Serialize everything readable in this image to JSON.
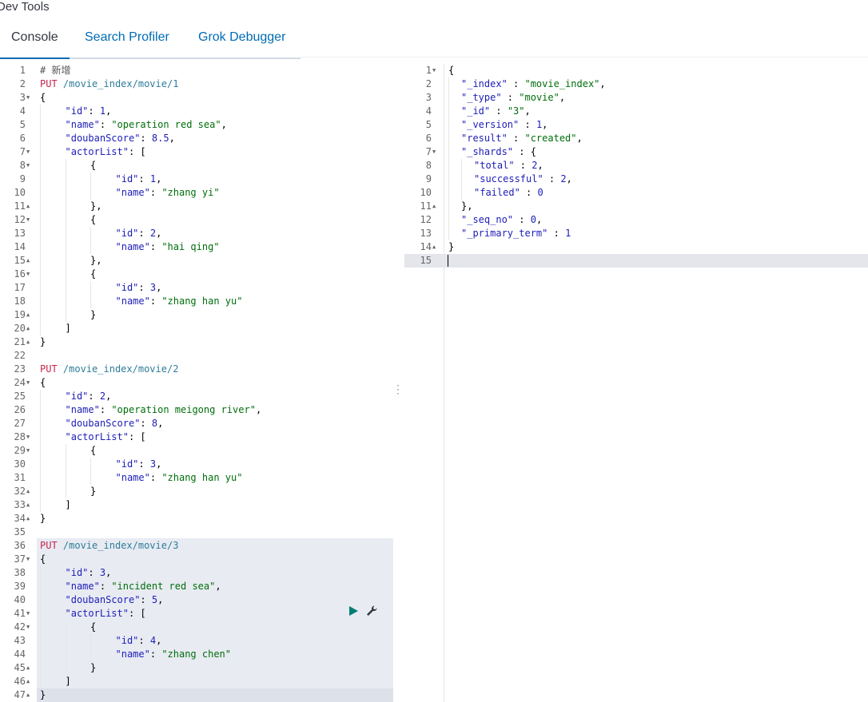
{
  "app_title": "Dev Tools",
  "tabs": [
    {
      "label": "Console"
    },
    {
      "label": "Search Profiler"
    },
    {
      "label": "Grok Debugger"
    }
  ],
  "request_editor": {
    "lines": [
      {
        "n": "1",
        "t": "# 新增",
        "s": "comment",
        "i": 0,
        "f": ""
      },
      {
        "n": "2",
        "t": "PUT /movie_index/movie/1",
        "s": "req",
        "i": 0,
        "f": ""
      },
      {
        "n": "3",
        "t": "{",
        "s": "",
        "i": 0,
        "f": "open"
      },
      {
        "n": "4",
        "t": "\"id\": 1,",
        "s": "",
        "i": 1,
        "f": ""
      },
      {
        "n": "5",
        "t": "\"name\": \"operation red sea\",",
        "s": "",
        "i": 1,
        "f": ""
      },
      {
        "n": "6",
        "t": "\"doubanScore\": 8.5,",
        "s": "",
        "i": 1,
        "f": ""
      },
      {
        "n": "7",
        "t": "\"actorList\": [",
        "s": "",
        "i": 1,
        "f": "open"
      },
      {
        "n": "8",
        "t": "{",
        "s": "",
        "i": 2,
        "f": "open"
      },
      {
        "n": "9",
        "t": "\"id\": 1,",
        "s": "",
        "i": 3,
        "f": ""
      },
      {
        "n": "10",
        "t": "\"name\": \"zhang yi\"",
        "s": "",
        "i": 3,
        "f": ""
      },
      {
        "n": "11",
        "t": "},",
        "s": "",
        "i": 2,
        "f": "close"
      },
      {
        "n": "12",
        "t": "{",
        "s": "",
        "i": 2,
        "f": "open"
      },
      {
        "n": "13",
        "t": "\"id\": 2,",
        "s": "",
        "i": 3,
        "f": ""
      },
      {
        "n": "14",
        "t": "\"name\": \"hai qing\"",
        "s": "",
        "i": 3,
        "f": ""
      },
      {
        "n": "15",
        "t": "},",
        "s": "",
        "i": 2,
        "f": "close"
      },
      {
        "n": "16",
        "t": "{",
        "s": "",
        "i": 2,
        "f": "open"
      },
      {
        "n": "17",
        "t": "\"id\": 3,",
        "s": "",
        "i": 3,
        "f": ""
      },
      {
        "n": "18",
        "t": "\"name\": \"zhang han yu\"",
        "s": "",
        "i": 3,
        "f": ""
      },
      {
        "n": "19",
        "t": "}",
        "s": "",
        "i": 2,
        "f": "close"
      },
      {
        "n": "20",
        "t": "]",
        "s": "",
        "i": 1,
        "f": "close"
      },
      {
        "n": "21",
        "t": "}",
        "s": "",
        "i": 0,
        "f": "close"
      },
      {
        "n": "22",
        "t": "",
        "s": "",
        "i": 0,
        "f": ""
      },
      {
        "n": "23",
        "t": "PUT /movie_index/movie/2",
        "s": "req",
        "i": 0,
        "f": ""
      },
      {
        "n": "24",
        "t": "{",
        "s": "",
        "i": 0,
        "f": "open"
      },
      {
        "n": "25",
        "t": "\"id\": 2,",
        "s": "",
        "i": 1,
        "f": ""
      },
      {
        "n": "26",
        "t": "\"name\": \"operation meigong river\",",
        "s": "",
        "i": 1,
        "f": ""
      },
      {
        "n": "27",
        "t": "\"doubanScore\": 8,",
        "s": "",
        "i": 1,
        "f": ""
      },
      {
        "n": "28",
        "t": "\"actorList\": [",
        "s": "",
        "i": 1,
        "f": "open"
      },
      {
        "n": "29",
        "t": "{",
        "s": "",
        "i": 2,
        "f": "open"
      },
      {
        "n": "30",
        "t": "\"id\": 3,",
        "s": "",
        "i": 3,
        "f": ""
      },
      {
        "n": "31",
        "t": "\"name\": \"zhang han yu\"",
        "s": "",
        "i": 3,
        "f": ""
      },
      {
        "n": "32",
        "t": "}",
        "s": "",
        "i": 2,
        "f": "close"
      },
      {
        "n": "33",
        "t": "]",
        "s": "",
        "i": 1,
        "f": "close"
      },
      {
        "n": "34",
        "t": "}",
        "s": "",
        "i": 0,
        "f": "close"
      },
      {
        "n": "35",
        "t": "",
        "s": "",
        "i": 0,
        "f": ""
      },
      {
        "n": "36",
        "t": "PUT /movie_index/movie/3",
        "s": "req",
        "i": 0,
        "f": ""
      },
      {
        "n": "37",
        "t": "{",
        "s": "",
        "i": 0,
        "f": "open"
      },
      {
        "n": "38",
        "t": "\"id\": 3,",
        "s": "",
        "i": 1,
        "f": ""
      },
      {
        "n": "39",
        "t": "\"name\": \"incident red sea\",",
        "s": "",
        "i": 1,
        "f": ""
      },
      {
        "n": "40",
        "t": "\"doubanScore\": 5,",
        "s": "",
        "i": 1,
        "f": ""
      },
      {
        "n": "41",
        "t": "\"actorList\": [",
        "s": "",
        "i": 1,
        "f": "open"
      },
      {
        "n": "42",
        "t": "{",
        "s": "",
        "i": 2,
        "f": "open"
      },
      {
        "n": "43",
        "t": "\"id\": 4,",
        "s": "",
        "i": 3,
        "f": ""
      },
      {
        "n": "44",
        "t": "\"name\": \"zhang chen\"",
        "s": "",
        "i": 3,
        "f": ""
      },
      {
        "n": "45",
        "t": "}",
        "s": "",
        "i": 2,
        "f": "close"
      },
      {
        "n": "46",
        "t": "]",
        "s": "",
        "i": 1,
        "f": "close"
      },
      {
        "n": "47",
        "t": "}",
        "s": "",
        "i": 0,
        "f": "close"
      }
    ]
  },
  "response_editor": {
    "lines": [
      {
        "n": "1",
        "t": "{",
        "i": 0,
        "f": "open"
      },
      {
        "n": "2",
        "t": "\"_index\" : \"movie_index\",",
        "i": 1,
        "f": ""
      },
      {
        "n": "3",
        "t": "\"_type\" : \"movie\",",
        "i": 1,
        "f": ""
      },
      {
        "n": "4",
        "t": "\"_id\" : \"3\",",
        "i": 1,
        "f": ""
      },
      {
        "n": "5",
        "t": "\"_version\" : 1,",
        "i": 1,
        "f": ""
      },
      {
        "n": "6",
        "t": "\"result\" : \"created\",",
        "i": 1,
        "f": ""
      },
      {
        "n": "7",
        "t": "\"_shards\" : {",
        "i": 1,
        "f": "open"
      },
      {
        "n": "8",
        "t": "\"total\" : 2,",
        "i": 2,
        "f": ""
      },
      {
        "n": "9",
        "t": "\"successful\" : 2,",
        "i": 2,
        "f": ""
      },
      {
        "n": "10",
        "t": "\"failed\" : 0",
        "i": 2,
        "f": ""
      },
      {
        "n": "11",
        "t": "},",
        "i": 1,
        "f": "close"
      },
      {
        "n": "12",
        "t": "\"_seq_no\" : 0,",
        "i": 1,
        "f": ""
      },
      {
        "n": "13",
        "t": "\"_primary_term\" : 1",
        "i": 1,
        "f": ""
      },
      {
        "n": "14",
        "t": "}",
        "i": 0,
        "f": "close"
      },
      {
        "n": "15",
        "t": "",
        "i": 0,
        "f": ""
      }
    ]
  },
  "actions": {
    "run_icon": "play-icon",
    "settings_icon": "wrench-icon"
  },
  "colors": {
    "accent": "#006bb4",
    "method": "#c7254e",
    "url": "#2e7d9a",
    "string": "#006e0b",
    "number": "#1d1db8",
    "run": "#017d73"
  }
}
